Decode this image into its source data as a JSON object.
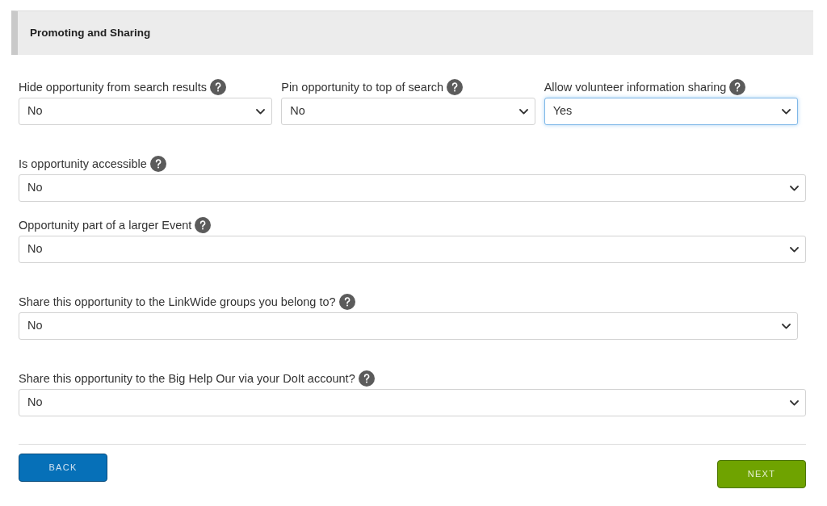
{
  "section": {
    "title": "Promoting and Sharing"
  },
  "rows": [
    {
      "fields": [
        {
          "label": "Hide opportunity from search results",
          "value": "No",
          "focused": false
        },
        {
          "label": "Pin opportunity to top of search",
          "value": "No",
          "focused": false
        },
        {
          "label": "Allow volunteer information sharing",
          "value": "Yes",
          "focused": true
        }
      ]
    },
    {
      "fields": [
        {
          "label": "Is opportunity accessible",
          "value": "No",
          "focused": false
        }
      ]
    },
    {
      "fields": [
        {
          "label": "Opportunity part of a larger Event",
          "value": "No",
          "focused": false
        }
      ]
    },
    {
      "fields": [
        {
          "label": "Share this opportunity to the LinkWide groups you belong to?",
          "value": "No",
          "focused": false
        }
      ]
    },
    {
      "fields": [
        {
          "label": "Share this opportunity to the Big Help Our via your DoIt account?",
          "value": "No",
          "focused": false
        }
      ]
    }
  ],
  "buttons": [
    {
      "label": "BACK",
      "kind": "back"
    },
    {
      "label": "NEXT",
      "kind": "next"
    }
  ]
}
